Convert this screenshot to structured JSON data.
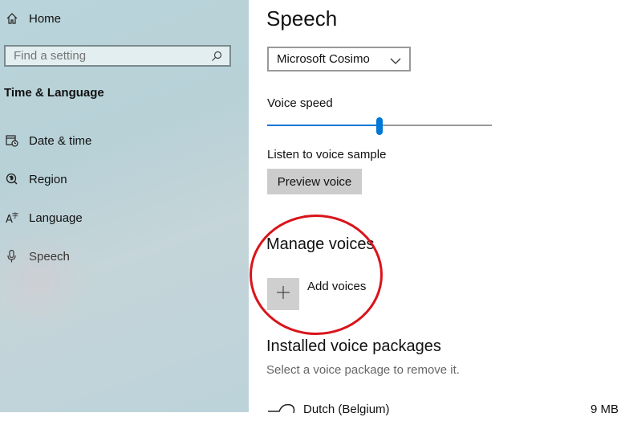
{
  "sidebar": {
    "home_label": "Home",
    "search_placeholder": "Find a setting",
    "section_title": "Time & Language",
    "items": [
      {
        "label": "Date & time",
        "icon": "calendar-clock-icon"
      },
      {
        "label": "Region",
        "icon": "globe-icon"
      },
      {
        "label": "Language",
        "icon": "language-icon"
      },
      {
        "label": "Speech",
        "icon": "microphone-icon"
      }
    ]
  },
  "main": {
    "title": "Speech",
    "voice_select": {
      "value": "Microsoft Cosimo"
    },
    "voice_speed": {
      "label": "Voice speed",
      "value_fraction": 0.5
    },
    "sample": {
      "label": "Listen to voice sample",
      "button": "Preview voice"
    },
    "manage_voices": {
      "heading": "Manage voices",
      "add_label": "Add voices"
    },
    "installed": {
      "heading": "Installed voice packages",
      "hint": "Select a voice package to remove it.",
      "packages": [
        {
          "name": "Dutch (Belgium)",
          "size": "9 MB"
        }
      ]
    }
  },
  "colors": {
    "accent": "#0078d7",
    "annotation_circle": "#d9141b"
  }
}
